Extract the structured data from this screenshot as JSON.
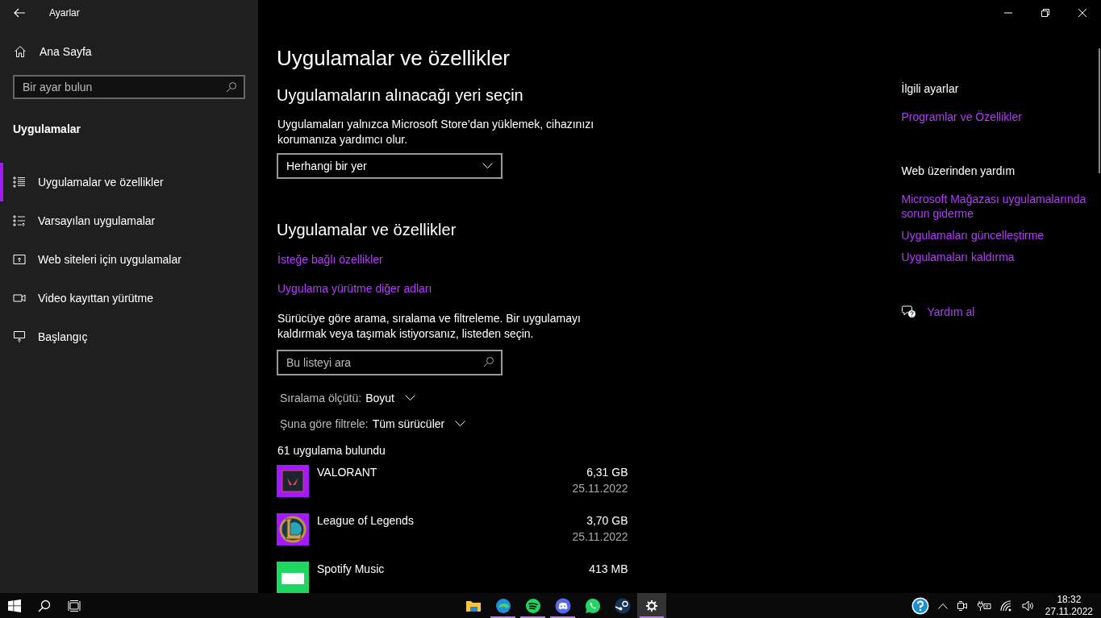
{
  "window": {
    "title": "Ayarlar"
  },
  "sidebar": {
    "home": "Ana Sayfa",
    "search": {
      "placeholder": "Bir ayar bulun"
    },
    "section": "Uygulamalar",
    "items": [
      {
        "kind": "list",
        "label": "Uygulamalar ve özellikler",
        "selected": true
      },
      {
        "kind": "defaults",
        "label": "Varsayılan uygulamalar",
        "selected": false
      },
      {
        "kind": "web",
        "label": "Web siteleri için uygulamalar",
        "selected": false
      },
      {
        "kind": "video",
        "label": "Video kayıttan yürütme",
        "selected": false
      },
      {
        "kind": "startup",
        "label": "Başlangıç",
        "selected": false
      }
    ]
  },
  "main": {
    "title": "Uygulamalar ve özellikler",
    "install_source": {
      "heading": "Uygulamaların alınacağı yeri seçin",
      "description": "Uygulamaları yalnızca Microsoft Store’dan yüklemek, cihazınızı korumanıza yardımcı olur.",
      "dropdown": "Herhangi bir yer"
    },
    "apps": {
      "heading": "Uygulamalar ve özellikler",
      "links": [
        "İsteğe bağlı özellikler",
        "Uygulama yürütme diğer adları"
      ],
      "description": "Sürücüye göre arama, sıralama ve filtreleme. Bir uygulamayı kaldırmak veya taşımak istiyorsanız, listeden seçin.",
      "search": {
        "placeholder": "Bu listeyi ara"
      },
      "sort": {
        "label": "Sıralama ölçütü:",
        "value": "Boyut"
      },
      "filter": {
        "label": "Şuna göre filtrele:",
        "value": "Tüm sürücüler"
      },
      "count": "61 uygulama bulundu",
      "list": [
        {
          "kind": "valorant",
          "name": "VALORANT",
          "size": "6,31 GB",
          "date": "25.11.2022"
        },
        {
          "kind": "league",
          "name": "League of Legends",
          "size": "3,70 GB",
          "date": "25.11.2022"
        },
        {
          "kind": "spotify",
          "name": "Spotify Music",
          "size": "413 MB"
        }
      ]
    }
  },
  "related": {
    "heading": "İlgili ayarlar",
    "links": [
      "Programlar ve Özellikler"
    ]
  },
  "web_help": {
    "heading": "Web üzerinden yardım",
    "links": [
      "Microsoft Mağazası uygulamalarında sorun giderme",
      "Uygulamaları güncelleştirme",
      "Uygulamaları kaldırma"
    ]
  },
  "help": "Yardım al",
  "taskbar": {
    "apps": [
      {
        "kind": "explorer",
        "running": false,
        "selected": false
      },
      {
        "kind": "edge",
        "running": true,
        "selected": false
      },
      {
        "kind": "spotify",
        "running": true,
        "selected": false
      },
      {
        "kind": "discord",
        "running": true,
        "selected": false
      },
      {
        "kind": "whatsapp",
        "running": false,
        "selected": false
      },
      {
        "kind": "steam",
        "running": false,
        "selected": false
      },
      {
        "kind": "settings",
        "running": true,
        "selected": true
      }
    ],
    "time": "18:32",
    "date": "27.11.2022"
  }
}
